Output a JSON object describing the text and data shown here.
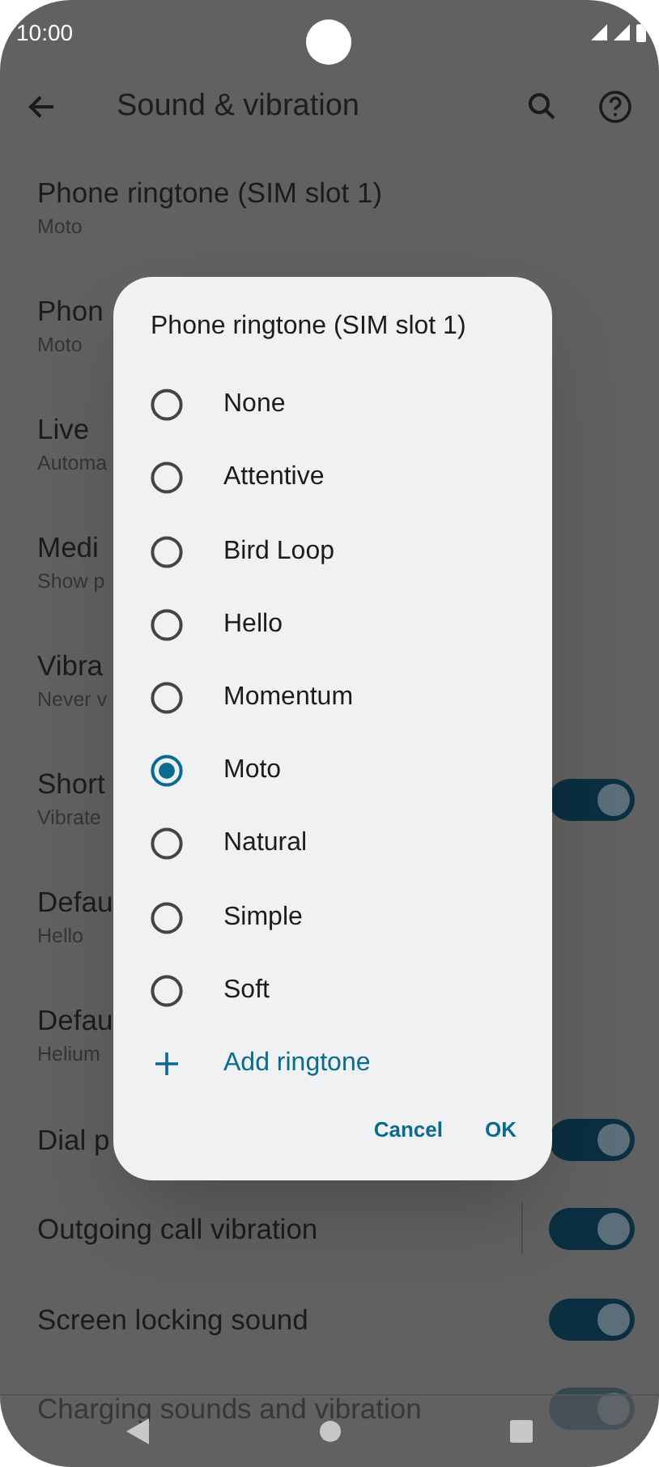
{
  "status_bar": {
    "time": "10:00"
  },
  "toolbar": {
    "title": "Sound & vibration"
  },
  "settings": [
    {
      "kind": "text",
      "title": "Phone ringtone (SIM slot 1)",
      "subtitle": "Moto"
    },
    {
      "kind": "text",
      "title": "Phon",
      "subtitle": "Moto"
    },
    {
      "kind": "text",
      "title": "Live",
      "subtitle": "Automa"
    },
    {
      "kind": "text",
      "title": "Medi",
      "subtitle": "Show p"
    },
    {
      "kind": "text",
      "title": "Vibra",
      "subtitle": "Never v"
    },
    {
      "kind": "toggle",
      "title": "Short",
      "subtitle": "Vibrate",
      "on": true
    },
    {
      "kind": "text",
      "title": "Defau",
      "subtitle": "Hello"
    },
    {
      "kind": "text",
      "title": "Defau",
      "subtitle": "Helium"
    },
    {
      "kind": "toggle",
      "title": "Dial p",
      "on": true
    },
    {
      "kind": "toggle",
      "title": "Outgoing call vibration",
      "on": true,
      "divider": true
    },
    {
      "kind": "toggle",
      "title": "Screen locking sound",
      "on": true
    },
    {
      "kind": "toggle",
      "title": "Charging sounds and vibration",
      "on": true
    }
  ],
  "dialog": {
    "title": "Phone ringtone (SIM slot 1)",
    "options": [
      {
        "label": "None",
        "selected": false
      },
      {
        "label": "Attentive",
        "selected": false
      },
      {
        "label": "Bird Loop",
        "selected": false
      },
      {
        "label": "Hello",
        "selected": false
      },
      {
        "label": "Momentum",
        "selected": false
      },
      {
        "label": "Moto",
        "selected": true
      },
      {
        "label": "Natural",
        "selected": false
      },
      {
        "label": "Simple",
        "selected": false
      },
      {
        "label": "Soft",
        "selected": false
      }
    ],
    "add_label": "Add ringtone",
    "buttons": [
      "Cancel",
      "OK"
    ]
  }
}
